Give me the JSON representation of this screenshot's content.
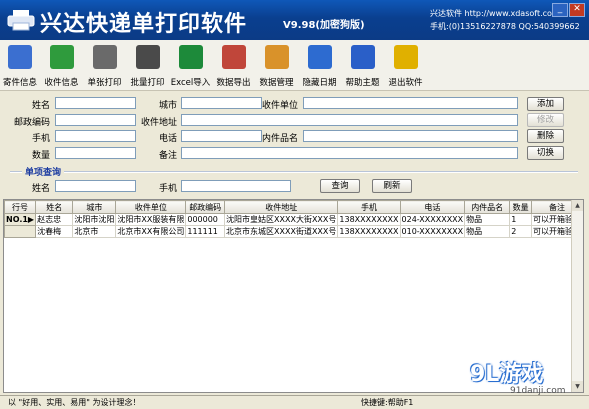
{
  "window": {
    "title": "兴达快递单打印软件",
    "version": "V9.98(加密狗版)",
    "info_line1": "兴达软件  http://www.xdasoft.com",
    "info_line2": "手机:(0)13516227878 QQ:540399662"
  },
  "toolbar": [
    {
      "label": "寄件信息",
      "icon": "user-icon",
      "color": "#3b6fd0"
    },
    {
      "label": "收件信息",
      "icon": "users-icon",
      "color": "#2f9b3d"
    },
    {
      "label": "单张打印",
      "icon": "printer-icon",
      "color": "#6a6a6a"
    },
    {
      "label": "批量打印",
      "icon": "printer-batch-icon",
      "color": "#4a4a4a"
    },
    {
      "label": "Excel导入",
      "icon": "excel-icon",
      "color": "#1d8a3a"
    },
    {
      "label": "数据导出",
      "icon": "export-icon",
      "color": "#c0463a"
    },
    {
      "label": "数据管理",
      "icon": "box-icon",
      "color": "#d9922a"
    },
    {
      "label": "隐藏日期",
      "icon": "calendar-icon",
      "color": "#2d6bd0"
    },
    {
      "label": "帮助主题",
      "icon": "help-icon",
      "color": "#2a5fc8"
    },
    {
      "label": "退出软件",
      "icon": "exit-icon",
      "color": "#e0b000"
    }
  ],
  "form": {
    "name": "姓名",
    "city": "城市",
    "company": "收件单位",
    "postcode": "邮政编码",
    "address": "收件地址",
    "mobile": "手机",
    "phone": "电话",
    "product": "内件品名",
    "quantity": "数量",
    "remark": "备注"
  },
  "buttons": {
    "add": "添加",
    "modify": "修改",
    "delete": "删除",
    "switch": "切换",
    "query": "查询",
    "refresh": "刷新"
  },
  "query": {
    "title": "单项查询",
    "name": "姓名",
    "mobile": "手机"
  },
  "table": {
    "columns": [
      "行号",
      "姓名",
      "城市",
      "收件单位",
      "邮政编码",
      "收件地址",
      "手机",
      "电话",
      "内件品名",
      "数量",
      "备注"
    ],
    "rows": [
      [
        "NO.1▶",
        "赵志忠",
        "沈阳市沈阳",
        "沈阳市XX服装有限",
        "000000",
        "沈阳市皇姑区XXXX大街XXX号",
        "138XXXXXXXX",
        "024-XXXXXXXX",
        "物品",
        "1",
        "可以开箱验货"
      ],
      [
        "",
        "沈春梅",
        "北京市",
        "北京市XX有限公司",
        "111111",
        "北京市东城区XXXX街道XXX号",
        "138XXXXXXXX",
        "010-XXXXXXXX",
        "物品",
        "2",
        "可以开箱验货"
      ]
    ]
  },
  "status": {
    "left": "以 \"好用、实用、易用\" 为设计理念！",
    "right": "快捷键:帮助F1"
  },
  "watermark": {
    "logo": "9L游戏",
    "url": "91danji.com"
  }
}
